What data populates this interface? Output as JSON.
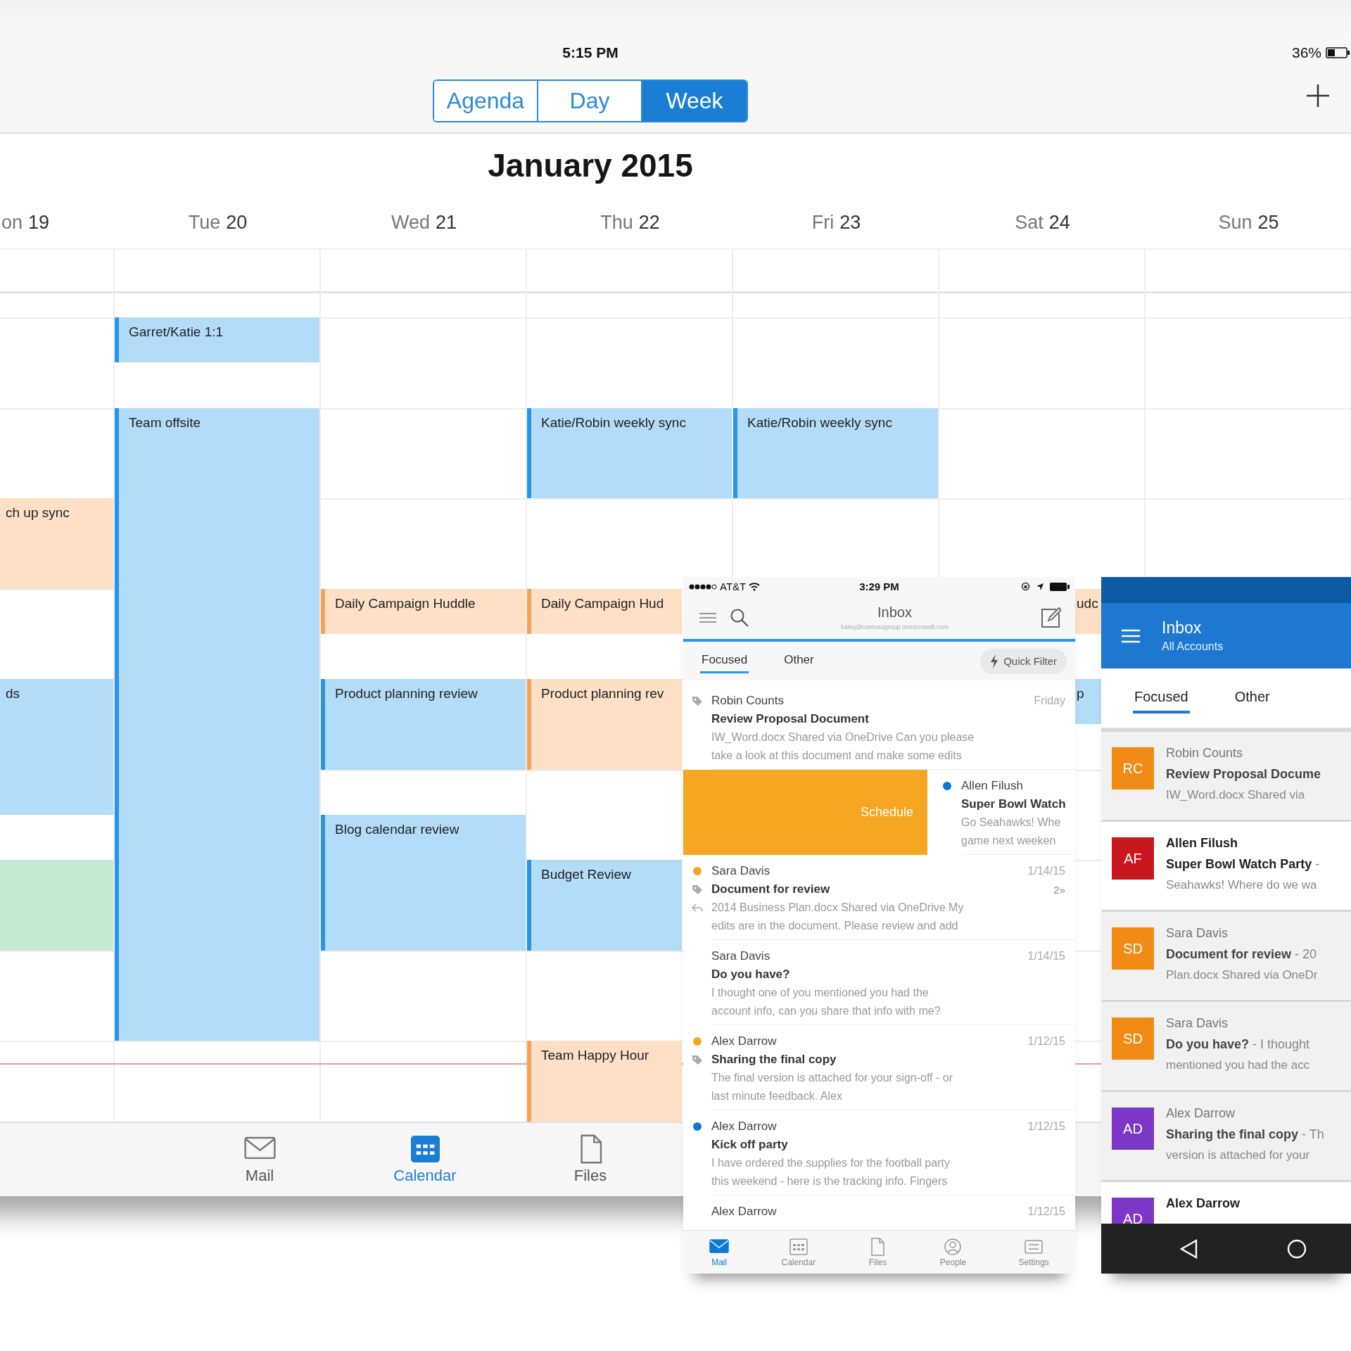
{
  "tablet": {
    "status_bar": {
      "time": "5:15 PM",
      "battery": "36%"
    },
    "view_switcher": [
      {
        "label": "Agenda",
        "selected": false
      },
      {
        "label": "Day",
        "selected": false
      },
      {
        "label": "Week",
        "selected": true
      }
    ],
    "month_title": "January 2015",
    "days": [
      {
        "dow": "on",
        "num": "19",
        "kind": "cut",
        "events": [
          {
            "title": "ch up sync",
            "color": "#fde0c6",
            "kind": "cut"
          },
          {
            "title": "ds",
            "color": "#b3dcf9",
            "kind": "cut"
          },
          {
            "color": "#c4ebd2",
            "kind": "cut"
          }
        ]
      },
      {
        "dow": "Tue",
        "num": "20",
        "kind": "full",
        "events": [
          {
            "title": "Garret/Katie 1:1",
            "color": "#b3dcf9",
            "kind": "full"
          },
          {
            "title": "Team offsite",
            "color": "#b3dcf9",
            "kind": "full"
          }
        ]
      },
      {
        "dow": "Wed",
        "num": "21",
        "kind": "full",
        "events": [
          {
            "title": "Daily Campaign Huddle",
            "color": "#fde0c6",
            "kind": "full"
          },
          {
            "title": "Product planning review",
            "color": "#b3dcf9",
            "kind": "full"
          },
          {
            "title": "Blog calendar review",
            "color": "#b3dcf9",
            "kind": "full"
          }
        ]
      },
      {
        "dow": "Thu",
        "num": "22",
        "kind": "full",
        "events": [
          {
            "title": "Katie/Robin weekly sync",
            "color": "#b3dcf9",
            "kind": "full"
          },
          {
            "title": "Daily Campaign Hud",
            "color": "#fde0c6",
            "kind": "covered"
          },
          {
            "title": "Product planning rev",
            "color": "#fde0c6",
            "kind": "covered"
          },
          {
            "title": "Budget Review",
            "color": "#b3dcf9",
            "kind": "covered"
          },
          {
            "title": "Team Happy Hour",
            "color": "#fde0c6",
            "kind": "covered"
          }
        ]
      },
      {
        "dow": "Fri",
        "num": "23",
        "kind": "full",
        "events": [
          {
            "title": "Katie/Robin weekly sync",
            "color": "#b3dcf9",
            "kind": "full"
          }
        ]
      },
      {
        "dow": "Sat",
        "num": "24",
        "kind": "full",
        "events": [
          {
            "title": "udc",
            "color": "#fde0c6",
            "kind": "peek"
          },
          {
            "title": "p",
            "color": "#b3dcf9",
            "kind": "peek"
          }
        ]
      },
      {
        "dow": "Sun",
        "num": "25",
        "kind": "full"
      }
    ],
    "tab_bar": [
      {
        "label": "Mail",
        "selected": false
      },
      {
        "label": "Calendar",
        "selected": true
      },
      {
        "label": "Files",
        "selected": false
      }
    ]
  },
  "phone": {
    "status_bar": {
      "carrier": "AT&T",
      "time": "3:29 PM"
    },
    "header": {
      "title": "Inbox",
      "account": "katiej@contosogroup.onmicrosoft.com"
    },
    "tabs": [
      {
        "label": "Focused",
        "selected": true
      },
      {
        "label": "Other",
        "selected": false
      }
    ],
    "quick_filter": "Quick Filter",
    "messages": [
      {
        "sender": "Robin Counts",
        "date": "Friday",
        "subject": "Review Proposal Document",
        "preview_lines": [
          "IW_Word.docx Shared via OneDrive Can you please",
          "take a look at this document and make some edits"
        ],
        "tagged": true,
        "replied": false
      },
      {
        "sender": "Allen Filush",
        "subject": "Super Bowl Watch",
        "preview_lines": [
          "Go Seahawks! Whe",
          "game next weeken"
        ],
        "color": "#0f78d4",
        "tagged": false,
        "replied": false,
        "swipe_action": "Schedule"
      },
      {
        "sender": "Sara Davis",
        "date": "1/14/15",
        "subject": "Document for review",
        "count": "2»",
        "preview_lines": [
          "2014 Business Plan.docx Shared via OneDrive  My",
          "edits are in the document. Please review and add"
        ],
        "color": "#f5a623",
        "tagged": true,
        "replied": true
      },
      {
        "sender": "Sara Davis",
        "date": "1/14/15",
        "subject": "Do you have?",
        "preview_lines": [
          "I thought one of you mentioned you had the",
          "account info, can you share that info with me?"
        ],
        "tagged": false,
        "replied": false
      },
      {
        "sender": "Alex Darrow",
        "date": "1/12/15",
        "subject": "Sharing the final copy",
        "preview_lines": [
          "The final version is attached for your sign-off - or",
          "last minute feedback. Alex"
        ],
        "color": "#f5a623",
        "tagged": true,
        "replied": false
      },
      {
        "sender": "Alex Darrow",
        "date": "1/12/15",
        "subject": "Kick off party",
        "preview_lines": [
          "I have ordered the supplies for the football party",
          "this weekend - here is the tracking info. Fingers"
        ],
        "color": "#0f78d4",
        "tagged": false,
        "replied": false
      },
      {
        "sender": "Alex Darrow",
        "date": "1/12/15",
        "tagged": false,
        "replied": false
      }
    ],
    "tab_bar": [
      {
        "label": "Mail",
        "selected": true
      },
      {
        "label": "Calendar",
        "selected": false
      },
      {
        "label": "Files",
        "selected": false
      },
      {
        "label": "People",
        "selected": false
      },
      {
        "label": "Settings",
        "selected": false
      }
    ]
  },
  "android": {
    "app_bar": {
      "title": "Inbox",
      "subtitle": "All Accounts"
    },
    "tabs": [
      {
        "label": "Focused",
        "selected": true
      },
      {
        "label": "Other",
        "selected": false
      }
    ],
    "messages": [
      {
        "initials": "RC",
        "color": "#f28a16",
        "unread": false,
        "sender": "Robin Counts",
        "subject_line": "**Review Proposal Docume**",
        "preview": "IW_Word.docx Shared via"
      },
      {
        "initials": "AF",
        "color": "#c8171e",
        "unread": true,
        "sender": "Allen Filush",
        "subject_line": "**Super Bowl Watch Party** -",
        "preview": "Seahawks! Where do we wa"
      },
      {
        "initials": "SD",
        "color": "#f28a16",
        "unread": false,
        "sender": "Sara Davis",
        "subject_line": "**Document for review** - 20",
        "preview": "Plan.docx Shared via OneDr"
      },
      {
        "initials": "SD",
        "color": "#f28a16",
        "unread": false,
        "sender": "Sara Davis",
        "subject_line": "**Do you have?** - I thought",
        "preview": "mentioned you had the acc"
      },
      {
        "initials": "AD",
        "color": "#7c36c8",
        "unread": false,
        "sender": "Alex Darrow",
        "subject_line": "**Sharing the final copy** - Th",
        "preview": "version is attached for your"
      },
      {
        "initials": "AD",
        "color": "#7c36c8",
        "unread": true,
        "sender": "Alex Darrow"
      }
    ]
  }
}
